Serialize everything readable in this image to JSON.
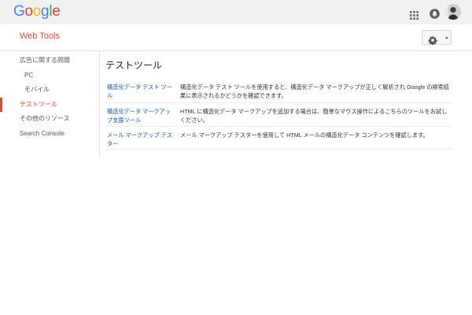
{
  "topbar": {
    "logo_letters": [
      {
        "char": "G",
        "color": "#4285f4"
      },
      {
        "char": "o",
        "color": "#ea4335"
      },
      {
        "char": "o",
        "color": "#fbbc05"
      },
      {
        "char": "g",
        "color": "#4285f4"
      },
      {
        "char": "l",
        "color": "#34a853"
      },
      {
        "char": "e",
        "color": "#ea4335"
      }
    ],
    "apps_icon": "apps-grid-icon",
    "notification_icon": "notifications-bell-icon",
    "avatar_icon": "account-avatar"
  },
  "header": {
    "product_title": "Web Tools",
    "settings_icon": "gear-icon",
    "dropdown_icon": "caret-down-icon"
  },
  "sidebar": {
    "items": [
      {
        "label": "広告に関する問題",
        "level": 0,
        "active": false
      },
      {
        "label": "PC",
        "level": 1,
        "active": false
      },
      {
        "label": "モバイル",
        "level": 1,
        "active": false
      },
      {
        "label": "テストツール",
        "level": 0,
        "active": true
      },
      {
        "label": "その他のリソース",
        "level": 0,
        "active": false
      },
      {
        "label": "Search Console",
        "level": 0,
        "active": false
      }
    ]
  },
  "main": {
    "title": "テストツール",
    "tools": [
      {
        "name": "構造化データ テスト ツール",
        "description": "構造化データ テスト ツールを使用すると、構造化データ マークアップが正しく解析され Google の検索結果に表示されるかどうかを確認できます。"
      },
      {
        "name": "構造化データ マークアップ支援ツール",
        "description": "HTML に構造化データ マークアップを追加する場合は、簡単なマウス操作によるこちらのツールをお試しください。"
      },
      {
        "name": "メール マークアップ テスター",
        "description": "メール マークアップ テスターを使用して HTML メールの構造化データ コンテンツを確認します。"
      }
    ]
  },
  "colors": {
    "accent": "#dd4b39",
    "link": "#1a56b8",
    "topbar_bg": "#f1f1f1"
  }
}
